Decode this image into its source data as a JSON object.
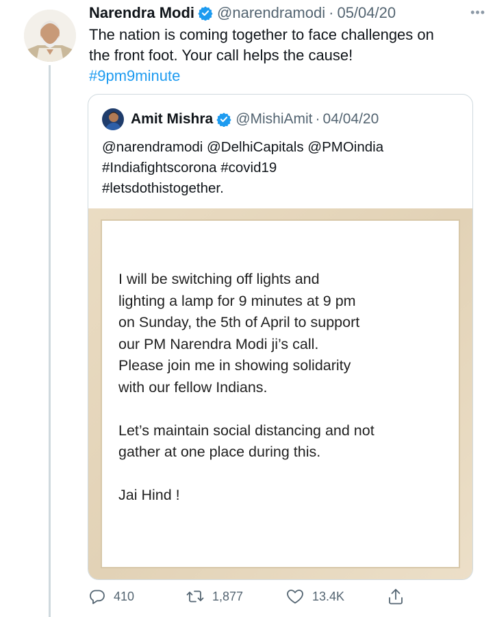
{
  "tweet": {
    "author_name": "Narendra Modi",
    "handle": "@narendramodi",
    "separator": "·",
    "date": "05/04/20",
    "more": "•••",
    "text_lines": [
      "The nation is coming together to face challenges on",
      "the front foot. Your call helps the cause!"
    ],
    "hashtag": "#9pm9minute"
  },
  "quoted": {
    "author_name": "Amit Mishra",
    "handle": "@MishiAmit",
    "separator": "·",
    "date": "04/04/20",
    "text_lines": [
      "@narendramodi @DelhiCapitals @PMOindia",
      "#Indiafightscorona #covid19",
      "#letsdothistogether."
    ],
    "image_text": {
      "paragraph1": [
        "I will be switching off lights and",
        "lighting a lamp for 9 minutes at 9 pm",
        "on Sunday, the 5th of April to support",
        "our PM Narendra Modi ji’s call.",
        "Please join me in showing solidarity",
        "with our fellow Indians."
      ],
      "paragraph2": [
        "Let’s maintain social distancing and not",
        "gather at one place during this."
      ],
      "paragraph3": [
        "Jai Hind !"
      ]
    }
  },
  "actions": {
    "reply_count": "410",
    "retweet_count": "1,877",
    "like_count": "13.4K"
  },
  "icons": {
    "verified": "verified-badge-icon",
    "reply": "reply-icon",
    "retweet": "retweet-icon",
    "like": "heart-icon",
    "share": "share-icon",
    "more": "more-icon"
  },
  "colors": {
    "link": "#1d9bf0",
    "secondary": "#536471",
    "verified": "#1d9bf0",
    "border": "#cfd9de"
  }
}
